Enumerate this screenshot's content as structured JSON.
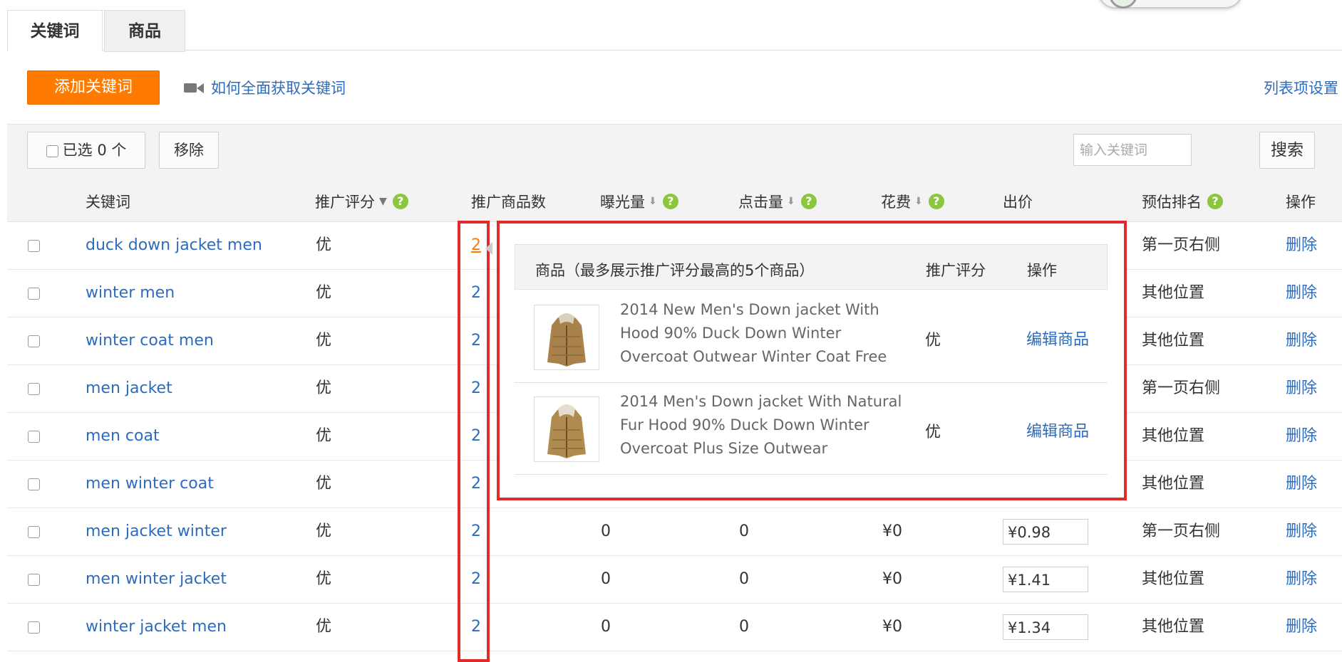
{
  "tabs": [
    {
      "label": "关键词",
      "active": true
    },
    {
      "label": "商品",
      "active": false
    }
  ],
  "actions": {
    "add_keyword": "添加关键词",
    "help_link": "如何全面获取关键词",
    "list_settings": "列表项设置"
  },
  "toolbar": {
    "selected": "已选 0 个",
    "remove": "移除",
    "search_placeholder": "输入关键词",
    "search_button": "搜索"
  },
  "table": {
    "headers": {
      "keyword": "关键词",
      "score": "推广评分",
      "product_count": "推广商品数",
      "exposure": "曝光量",
      "clicks": "点击量",
      "cost": "花费",
      "bid": "出价",
      "est_rank": "预估排名",
      "operation": "操作"
    },
    "rows": [
      {
        "keyword": "duck down jacket men",
        "score": "优",
        "count": "2",
        "exposure": "",
        "clicks": "",
        "cost": "",
        "bid": "",
        "rank": "第一页右侧",
        "op": "删除"
      },
      {
        "keyword": "winter men",
        "score": "优",
        "count": "2",
        "exposure": "",
        "clicks": "",
        "cost": "",
        "bid": "",
        "rank": "其他位置",
        "op": "删除"
      },
      {
        "keyword": "winter coat men",
        "score": "优",
        "count": "2",
        "exposure": "",
        "clicks": "",
        "cost": "",
        "bid": "",
        "rank": "其他位置",
        "op": "删除"
      },
      {
        "keyword": "men jacket",
        "score": "优",
        "count": "2",
        "exposure": "",
        "clicks": "",
        "cost": "",
        "bid": "",
        "rank": "第一页右侧",
        "op": "删除"
      },
      {
        "keyword": "men coat",
        "score": "优",
        "count": "2",
        "exposure": "",
        "clicks": "",
        "cost": "",
        "bid": "",
        "rank": "其他位置",
        "op": "删除"
      },
      {
        "keyword": "men winter coat",
        "score": "优",
        "count": "2",
        "exposure": "",
        "clicks": "",
        "cost": "",
        "bid": "",
        "rank": "其他位置",
        "op": "删除"
      },
      {
        "keyword": "men jacket winter",
        "score": "优",
        "count": "2",
        "exposure": "0",
        "clicks": "0",
        "cost": "¥0",
        "bid": "¥0.98",
        "rank": "第一页右侧",
        "op": "删除"
      },
      {
        "keyword": "men winter jacket",
        "score": "优",
        "count": "2",
        "exposure": "0",
        "clicks": "0",
        "cost": "¥0",
        "bid": "¥1.41",
        "rank": "其他位置",
        "op": "删除"
      },
      {
        "keyword": "winter jacket men",
        "score": "优",
        "count": "2",
        "exposure": "0",
        "clicks": "0",
        "cost": "¥0",
        "bid": "¥1.34",
        "rank": "其他位置",
        "op": "删除"
      }
    ]
  },
  "popup": {
    "header_product": "商品（最多展示推广评分最高的5个商品）",
    "header_score": "推广评分",
    "header_op": "操作",
    "products": [
      {
        "title": "2014 New Men's Down jacket With Hood 90% Duck Down Winter Overcoat Outwear Winter Coat Free",
        "score": "优",
        "op": "编辑商品"
      },
      {
        "title": "2014 Men's Down jacket With Natural Fur Hood 90% Duck Down Winter Overcoat Plus Size Outwear",
        "score": "优",
        "op": "编辑商品"
      }
    ]
  },
  "colors": {
    "accent_orange": "#ff7a00",
    "link_blue": "#2d6bbd",
    "highlight_red": "#e02b2b",
    "help_green": "#8cc63f"
  }
}
